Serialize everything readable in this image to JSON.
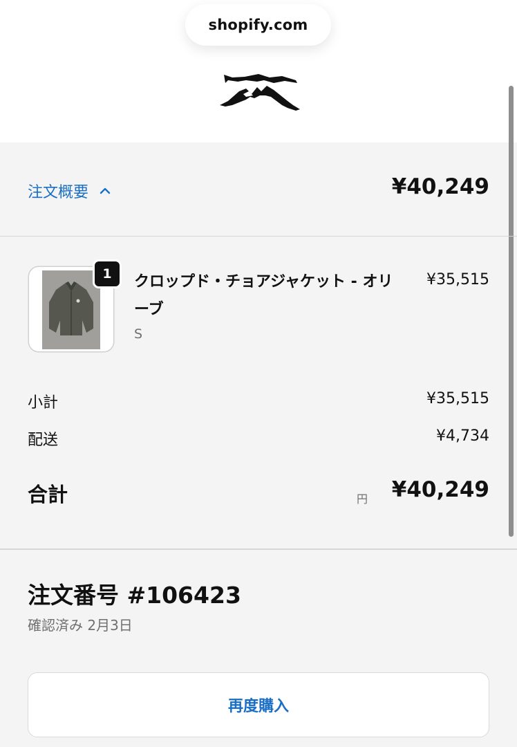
{
  "browser": {
    "url": "shopify.com"
  },
  "summary": {
    "toggle_label": "注文概要",
    "total": "¥40,249"
  },
  "product": {
    "quantity": "1",
    "name": "クロップド・チョアジャケット - オリーブ",
    "variant": "S",
    "price": "¥35,515"
  },
  "costs": {
    "subtotal_label": "小計",
    "subtotal_value": "¥35,515",
    "shipping_label": "配送",
    "shipping_value": "¥4,734",
    "total_label": "合計",
    "currency": "円",
    "total_value": "¥40,249"
  },
  "order": {
    "number": "注文番号 #106423",
    "status": "確認済み 2月3日"
  },
  "actions": {
    "reorder_label": "再度購入"
  },
  "colors": {
    "accent": "#1a6fc4",
    "background": "#f4f4f4"
  },
  "icons": {
    "toggle": "chevron-up-icon",
    "logo": "brand-logo"
  }
}
